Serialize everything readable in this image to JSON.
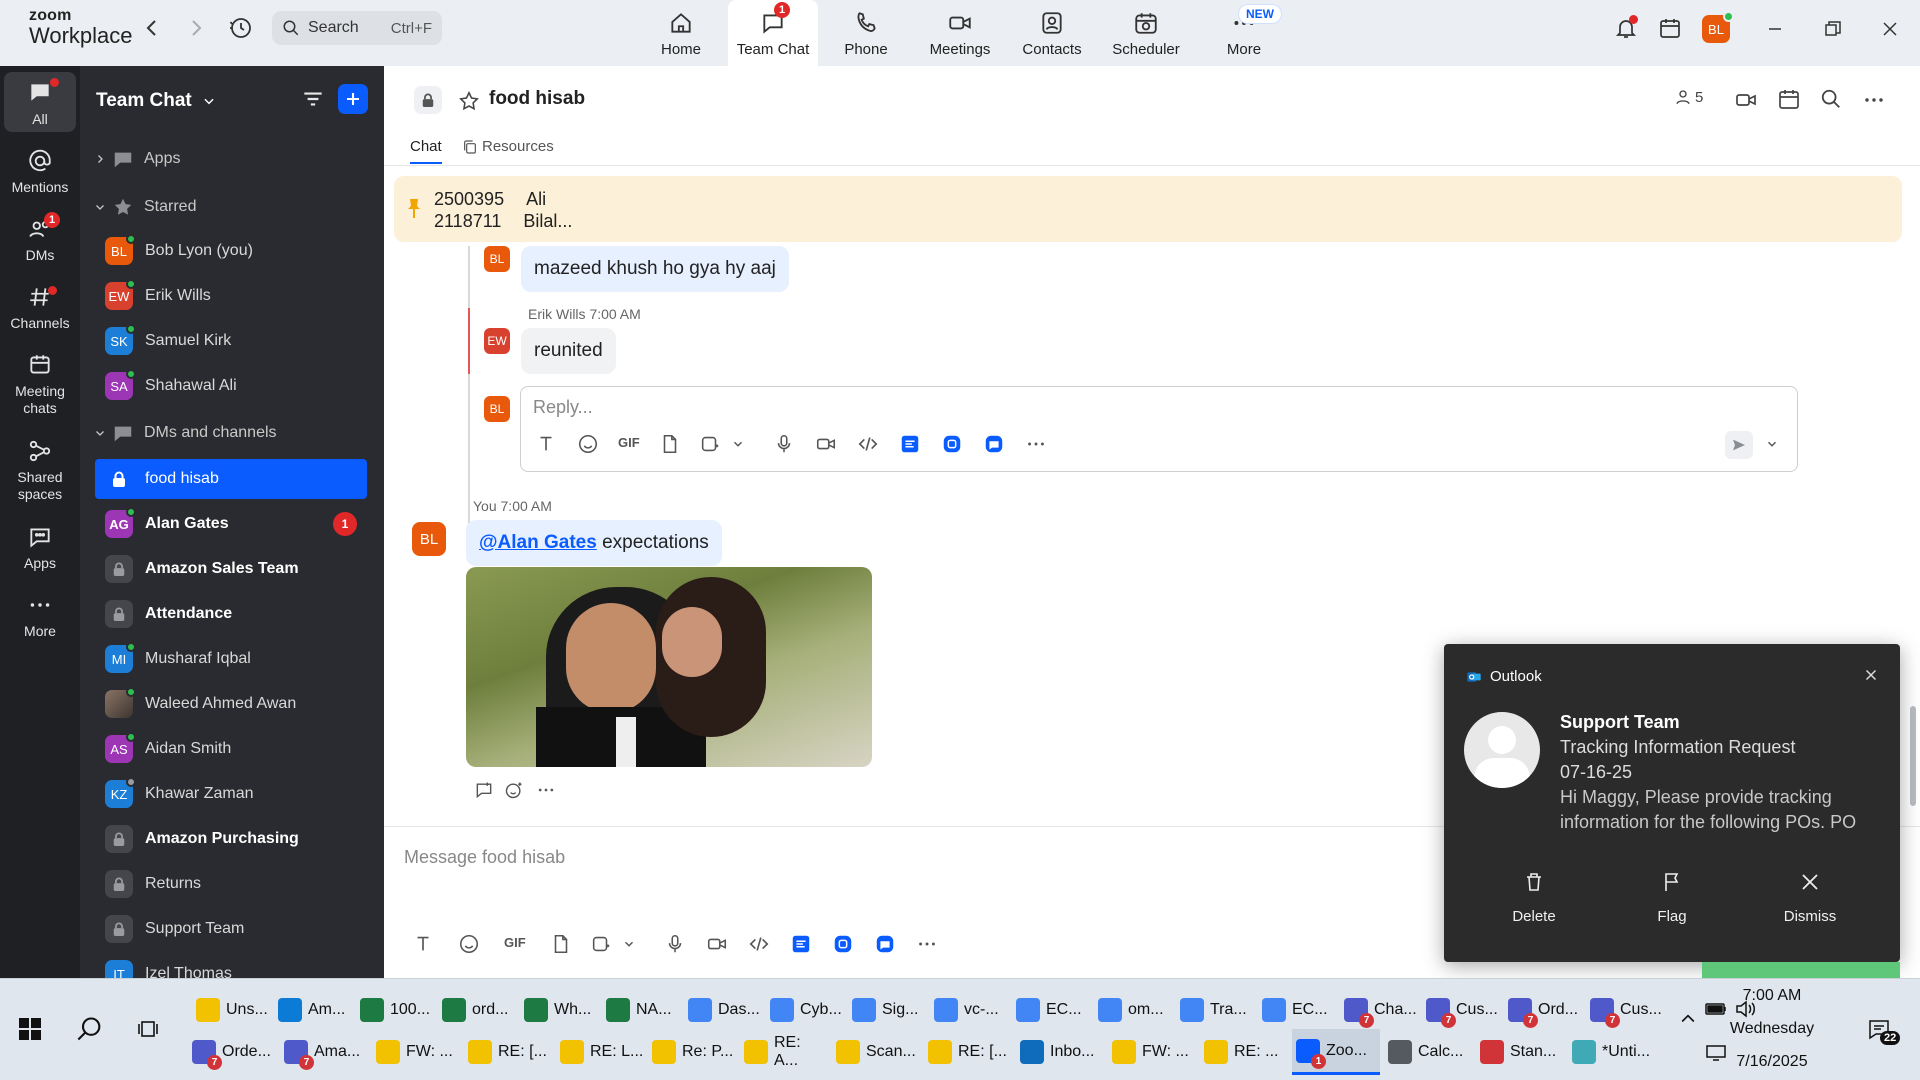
{
  "app": {
    "logo_line1": "zoom",
    "logo_line2": "Workplace"
  },
  "search": {
    "placeholder": "Search",
    "shortcut": "Ctrl+F"
  },
  "nav": {
    "tabs": [
      {
        "label": "Home"
      },
      {
        "label": "Team Chat",
        "badge": "1"
      },
      {
        "label": "Phone"
      },
      {
        "label": "Meetings"
      },
      {
        "label": "Contacts"
      },
      {
        "label": "Scheduler"
      },
      {
        "label": "More",
        "tag": "NEW"
      }
    ],
    "avatar": "BL"
  },
  "rail": {
    "items": [
      {
        "label": "All"
      },
      {
        "label": "Mentions"
      },
      {
        "label": "DMs",
        "badge": "1"
      },
      {
        "label": "Channels"
      },
      {
        "label": "Meeting chats"
      },
      {
        "label": "Shared spaces"
      },
      {
        "label": "Apps"
      },
      {
        "label": "More"
      }
    ]
  },
  "sidebar": {
    "title": "Team Chat",
    "apps_label": "Apps",
    "starred_label": "Starred",
    "dms_label": "DMs and channels",
    "starred": [
      {
        "initials": "BL",
        "name": "Bob Lyon (you)",
        "color": "#e8590c"
      },
      {
        "initials": "EW",
        "name": "Erik Wills",
        "color": "#d9412f"
      },
      {
        "initials": "SK",
        "name": "Samuel Kirk",
        "color": "#1c7ed6"
      },
      {
        "initials": "SA",
        "name": "Shahawal Ali",
        "color": "#9c36b5"
      }
    ],
    "channels": [
      {
        "name": "food hisab"
      },
      {
        "initials": "AG",
        "name": "Alan Gates",
        "color": "#9c36b5",
        "count": "1"
      },
      {
        "name": "Amazon Sales Team"
      },
      {
        "name": "Attendance"
      },
      {
        "initials": "MI",
        "name": "Musharaf Iqbal",
        "color": "#1c7ed6"
      },
      {
        "initials": "",
        "name": "Waleed Ahmed Awan",
        "color": "#6b5a4b"
      },
      {
        "initials": "AS",
        "name": "Aidan Smith",
        "color": "#9c36b5"
      },
      {
        "initials": "KZ",
        "name": "Khawar Zaman",
        "color": "#1c7ed6"
      },
      {
        "name": "Amazon Purchasing"
      },
      {
        "name": "Returns"
      },
      {
        "name": "Support Team"
      },
      {
        "initials": "IT",
        "name": "Izel Thomas",
        "color": "#1c7ed6"
      }
    ]
  },
  "channel": {
    "title": "food hisab",
    "member_count": "5",
    "tabs": [
      "Chat",
      "Resources"
    ],
    "pinned": {
      "line1_id": "2500395",
      "line1_name": "Ali",
      "line2_id": "2118711",
      "line2_name": "Bilal..."
    },
    "thread": [
      {
        "initials": "BL",
        "text": "mazeed khush ho gya hy aaj"
      },
      {
        "initials": "EW",
        "author": "Erik Wills",
        "time": "7:00 AM",
        "text": "reunited"
      }
    ],
    "reply_placeholder": "Reply...",
    "message": {
      "initials": "BL",
      "author": "You",
      "time": "7:00 AM",
      "mention": "@Alan Gates",
      "text": " expectations"
    },
    "composer_placeholder": "Message food hisab",
    "gif_label": "GIF"
  },
  "toast": {
    "app": "Outlook",
    "sender": "Support Team",
    "subject": "Tracking Information Request",
    "date": "07-16-25",
    "preview": "Hi Maggy,  Please provide tracking information for the following POs.  PO",
    "actions": [
      "Delete",
      "Flag",
      "Dismiss"
    ]
  },
  "taskbar": {
    "row1": [
      {
        "label": "Uns...",
        "color": "#f2c200"
      },
      {
        "label": "Am...",
        "color": "#0c7bd6"
      },
      {
        "label": "100...",
        "color": "#1d7a43"
      },
      {
        "label": "ord...",
        "color": "#1d7a43"
      },
      {
        "label": "Wh...",
        "color": "#1d7a43"
      },
      {
        "label": "NA...",
        "color": "#1d7a43"
      },
      {
        "label": "Das...",
        "color": "#4285f4"
      },
      {
        "label": "Cyb...",
        "color": "#4285f4"
      },
      {
        "label": "Sig...",
        "color": "#4285f4"
      },
      {
        "label": "vc-...",
        "color": "#4285f4"
      },
      {
        "label": "EC...",
        "color": "#4285f4"
      },
      {
        "label": "om...",
        "color": "#4285f4"
      },
      {
        "label": "Tra...",
        "color": "#4285f4"
      },
      {
        "label": "EC...",
        "color": "#4285f4"
      },
      {
        "label": "Cha...",
        "color": "#5059c9",
        "badge": "7"
      },
      {
        "label": "Cus...",
        "color": "#5059c9",
        "badge": "7"
      },
      {
        "label": "Ord...",
        "color": "#5059c9",
        "badge": "7"
      },
      {
        "label": "Cus...",
        "color": "#5059c9",
        "badge": "7"
      }
    ],
    "row2": [
      {
        "label": "Orde...",
        "color": "#5059c9",
        "badge": "7"
      },
      {
        "label": "Ama...",
        "color": "#5059c9",
        "badge": "7"
      },
      {
        "label": "FW: ...",
        "color": "#f2c200"
      },
      {
        "label": "RE: [...",
        "color": "#f2c200"
      },
      {
        "label": "RE: L...",
        "color": "#f2c200"
      },
      {
        "label": "Re: P...",
        "color": "#f2c200"
      },
      {
        "label": "RE: A...",
        "color": "#f2c200"
      },
      {
        "label": "Scan...",
        "color": "#f2c200"
      },
      {
        "label": "RE: [...",
        "color": "#f2c200"
      },
      {
        "label": "Inbo...",
        "color": "#0f6cbd"
      },
      {
        "label": "FW: ...",
        "color": "#f2c200"
      },
      {
        "label": "RE: ...",
        "color": "#f2c200"
      },
      {
        "label": "Zoo...",
        "color": "#0b5cff",
        "badge": "1"
      },
      {
        "label": "Calc...",
        "color": "#555a60"
      },
      {
        "label": "Stan...",
        "color": "#d13438"
      },
      {
        "label": "*Unti...",
        "color": "#3fa9b5"
      }
    ],
    "time": "7:00 AM",
    "day": "Wednesday",
    "date": "7/16/2025",
    "notif_count": "22"
  }
}
